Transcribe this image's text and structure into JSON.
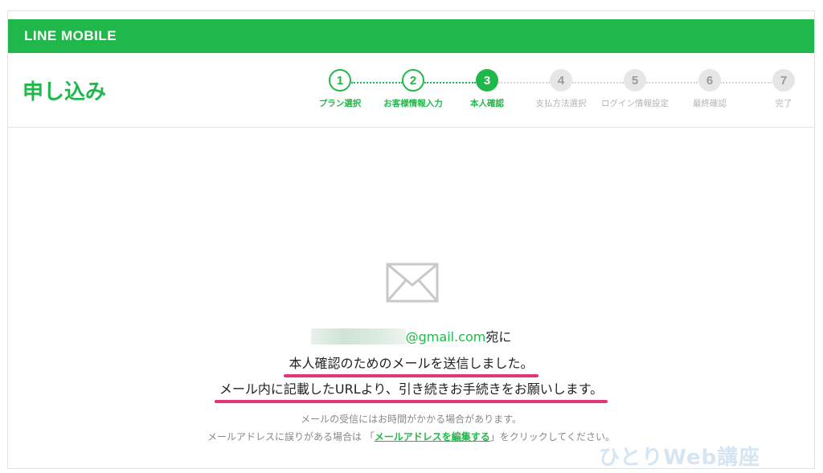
{
  "header": {
    "brand": "LINE MOBILE",
    "title": "申し込み"
  },
  "steps": [
    {
      "num": "1",
      "label": "プラン選択",
      "state": "done"
    },
    {
      "num": "2",
      "label": "お客様情報入力",
      "state": "done"
    },
    {
      "num": "3",
      "label": "本人確認",
      "state": "current"
    },
    {
      "num": "4",
      "label": "支払方法選択",
      "state": "todo"
    },
    {
      "num": "5",
      "label": "ログイン情報設定",
      "state": "todo"
    },
    {
      "num": "6",
      "label": "最終確認",
      "state": "todo"
    },
    {
      "num": "7",
      "label": "完了",
      "state": "todo"
    }
  ],
  "main": {
    "icon": "envelope-icon",
    "email_domain": "@gmail.com",
    "addressee_suffix": "宛に",
    "sent_message": "本人確認のためのメールを送信しました。",
    "instruction": "メール内に記載したURLより、引き続きお手続きをお願いします。",
    "note_delay": "メールの受信にはお時間がかかる場合があります。",
    "note_wrong_prefix": "メールアドレスに誤りがある場合は 「",
    "edit_link": "メールアドレスを編集する",
    "note_wrong_suffix": "」をクリックしてください。"
  },
  "watermark": "ひとりWeb講座",
  "colors": {
    "brand_green": "#20b84a",
    "highlight_pink": "#e8337c",
    "inactive_gray": "#e6e6e6"
  }
}
